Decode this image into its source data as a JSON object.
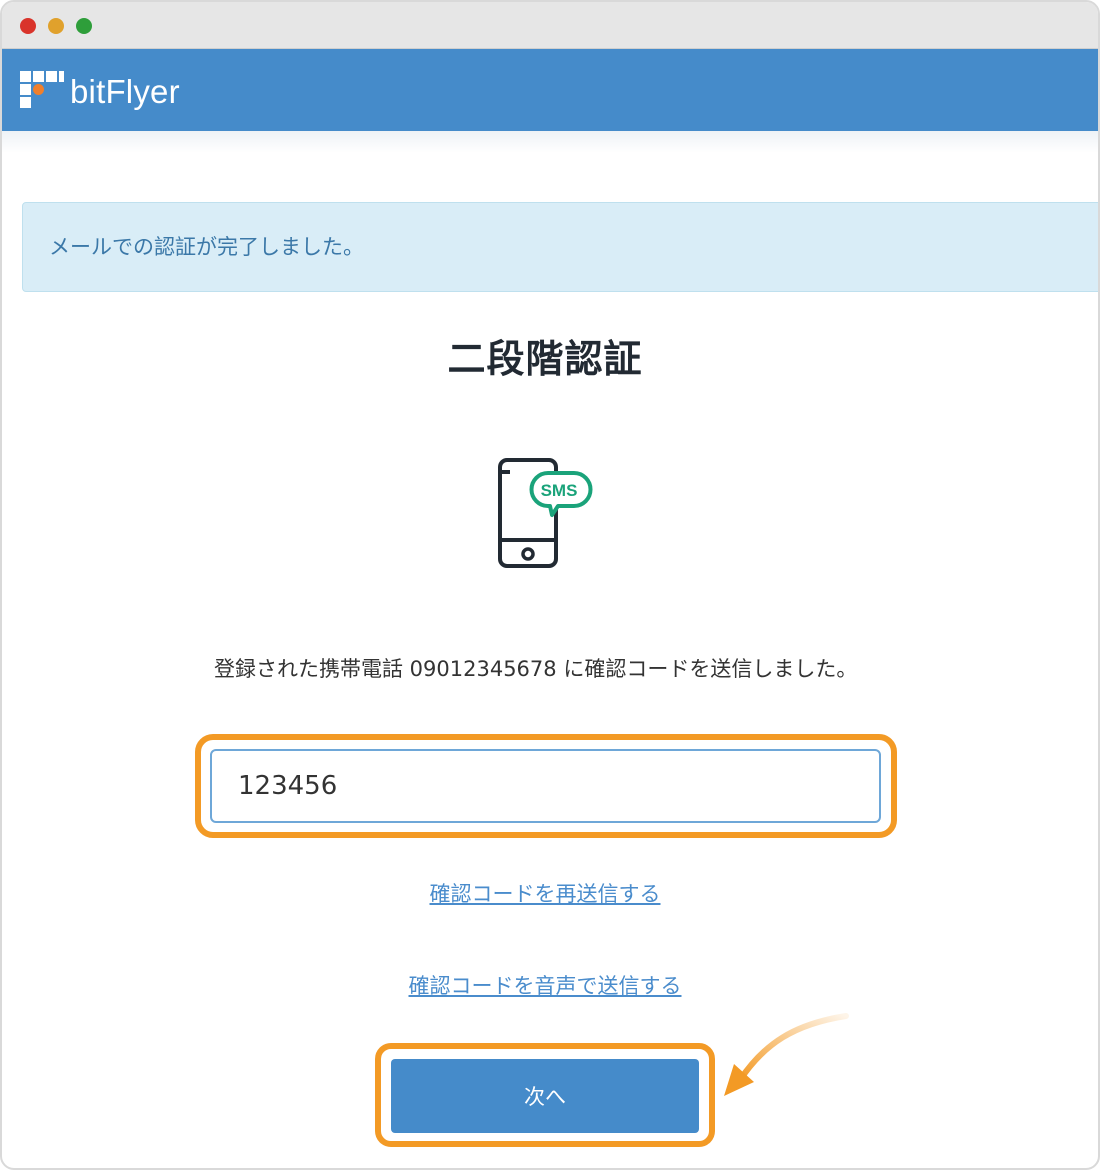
{
  "brand": {
    "name": "bitFlyer",
    "header_color": "#458bca",
    "accent_orange": "#f07f2b"
  },
  "alert": {
    "text": "メールでの認証が完了しました。"
  },
  "page": {
    "title": "二段階認証"
  },
  "illustration": {
    "icon": "phone-sms-icon",
    "badge_text": "SMS",
    "badge_color": "#1aa37a"
  },
  "message": {
    "text": "登録された携帯電話 09012345678 に確認コードを送信しました。"
  },
  "code_input": {
    "value": "123456"
  },
  "links": {
    "resend": "確認コードを再送信する",
    "voice": "確認コードを音声で送信する"
  },
  "next_button": {
    "label": "次へ"
  },
  "highlight": {
    "color": "#f39a25"
  }
}
